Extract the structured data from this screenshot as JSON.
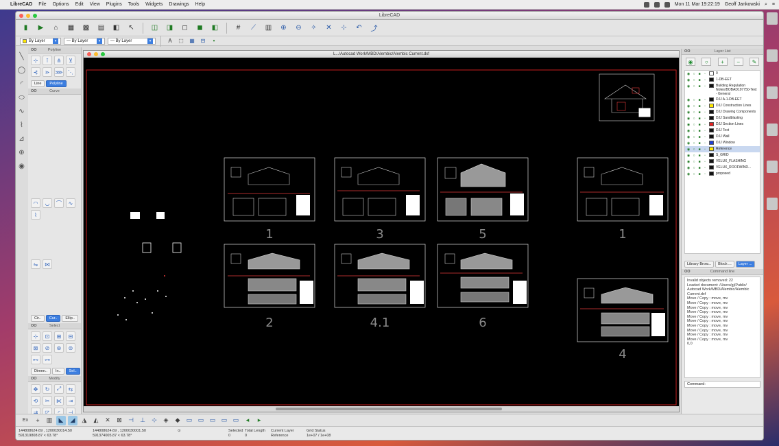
{
  "os_menu": {
    "apple": "",
    "app_name": "LibreCAD",
    "items": [
      "File",
      "Options",
      "Edit",
      "View",
      "Plugins",
      "Tools",
      "Widgets",
      "Drawings",
      "Help"
    ],
    "clock": "Mon 11 Mar 19:22:19",
    "user": "Geoff Jankowski"
  },
  "window": {
    "title": "LibreCAD"
  },
  "toolbar2": {
    "color_combo": "By Layer",
    "linetype_combo": "— By Layer",
    "width_combo": "— By Layer"
  },
  "left_panels": {
    "polyline_title": "Polyline",
    "line_tab": "Line",
    "polyline_tab": "Polyline",
    "curve_title": "Curve",
    "ellipse_tabs": [
      "Cir..",
      "Cur..",
      "Ellip.."
    ],
    "select_title": "Select",
    "dim_tabs": [
      "Dimen..",
      "In..",
      "Sel.."
    ],
    "modify_title": "Modify",
    "dock_label": "OO"
  },
  "drawing": {
    "title": "L.../Autocad Work/MBD/Alembic/Alembic Current.dxf",
    "sheet_labels": [
      "1",
      "3",
      "5",
      "1",
      "2",
      "4.1",
      "6",
      "4"
    ]
  },
  "layer_list": {
    "title": "Layer List",
    "layers": [
      {
        "name": "0",
        "color": "#ffffff"
      },
      {
        "name": "1-DB-EET",
        "color": "#111111"
      },
      {
        "name": "Building Regulation Notes/BOBAD197750-Text - General",
        "color": "#111111"
      },
      {
        "name": "DJJ A-1-DB-EET",
        "color": "#111111"
      },
      {
        "name": "DJJ Construction Lines",
        "color": "#ffe800"
      },
      {
        "name": "DJJ Drawing Components",
        "color": "#111111"
      },
      {
        "name": "DJJ Sandblasting",
        "color": "#111111"
      },
      {
        "name": "DJJ Section Lines",
        "color": "#e52222"
      },
      {
        "name": "DJJ Text",
        "color": "#111111"
      },
      {
        "name": "DJJ Wall",
        "color": "#111111"
      },
      {
        "name": "DJJ Window",
        "color": "#1e3fd6"
      },
      {
        "name": "Reference",
        "color": "#ffe800",
        "selected": true
      },
      {
        "name": "S_GRID",
        "color": "#111111"
      },
      {
        "name": "VELUX_FLASHING",
        "color": "#111111"
      },
      {
        "name": "VELUX_ROOFWIND...",
        "color": "#111111"
      },
      {
        "name": "proposed",
        "color": "#111111"
      }
    ]
  },
  "right_tabs": [
    "Library Brow...",
    "Block ...",
    "Layer ..."
  ],
  "command_history": {
    "title": "Command line",
    "lines": [
      "Invalid objects removed: 22",
      "Loaded document: /Users/gj/Public/",
      "Autocad Work/MBD/Alembic/Alembic",
      "Current.dxf",
      "Move / Copy : move, mv",
      "Move / Copy : move, mv",
      "Move / Copy : move, mv",
      "Move / Copy : move, mv",
      "Move / Copy : move, mv",
      "Move / Copy : move, mv",
      "Move / Copy : move, mv",
      "Move / Copy : move, mv",
      "Move / Copy : move, mv",
      "Move / Copy : move, mv",
      "0,0"
    ],
    "command_label": "Command:"
  },
  "status": {
    "abs_coords_1": "144808624.69 , 1200030014.50",
    "abs_coords_2": "144808624.69 , 1200030001.50",
    "rel_coords_1": "591319808.87 < 63.78°",
    "rel_coords_2": "591374005.87 < 63.78°",
    "selected_label": "Selected",
    "selected_value": "0",
    "total_length_label": "Total Length",
    "total_length_value": "0",
    "current_layer_label": "Current Layer",
    "current_layer_value": "Reference",
    "grid_label": "Grid Status",
    "grid_value": "1e+07 / 1e+08"
  },
  "snapbar": {
    "exit_label": "Ex"
  }
}
